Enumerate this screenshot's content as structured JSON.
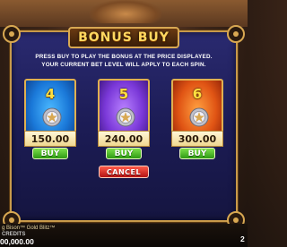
{
  "dialog": {
    "title": "BONUS BUY",
    "instruction_line1": "PRESS BUY TO PLAY THE BONUS AT THE PRICE DISPLAYED.",
    "instruction_line2": "YOUR CURRENT BET LEVEL WILL APPLY TO EACH SPIN."
  },
  "options": [
    {
      "level": "4",
      "price": "150.00",
      "buy_label": "BUY",
      "color": "#1a78d8"
    },
    {
      "level": "5",
      "price": "240.00",
      "buy_label": "BUY",
      "color": "#7a38d8"
    },
    {
      "level": "6",
      "price": "300.00",
      "buy_label": "BUY",
      "color": "#e05414"
    }
  ],
  "cancel_label": "CANCEL",
  "footer": {
    "game_name": "g Bison™ Gold Blitz™",
    "credits_label": "CREDITS",
    "credits_value": "00,000.00",
    "right_value": "2"
  },
  "colors": {
    "accent_gold": "#d8a852",
    "buy_green": "#2e9a14",
    "cancel_red": "#b41414",
    "panel_blue": "#1c1c55"
  }
}
